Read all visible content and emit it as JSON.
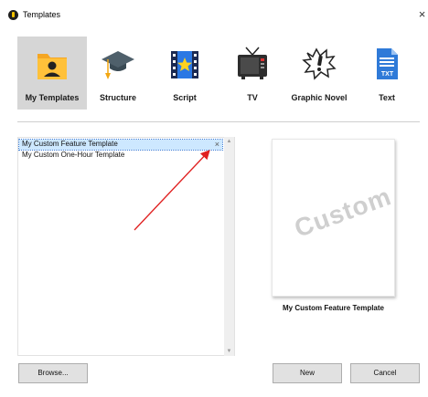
{
  "window": {
    "title": "Templates",
    "close_glyph": "×"
  },
  "categories": [
    {
      "label": "My Templates",
      "icon": "folder-user-icon",
      "selected": true
    },
    {
      "label": "Structure",
      "icon": "graduation-cap-icon",
      "selected": false
    },
    {
      "label": "Script",
      "icon": "film-strip-star-icon",
      "selected": false
    },
    {
      "label": "TV",
      "icon": "television-icon",
      "selected": false
    },
    {
      "label": "Graphic Novel",
      "icon": "speech-bubble-exclaim-icon",
      "selected": false
    },
    {
      "label": "Text",
      "icon": "txt-document-icon",
      "selected": false
    }
  ],
  "template_list": {
    "items": [
      {
        "label": "My Custom Feature Template",
        "selected": true,
        "delete_glyph": "×"
      },
      {
        "label": "My Custom One-Hour Template",
        "selected": false
      }
    ]
  },
  "preview": {
    "watermark": "Custom",
    "caption": "My Custom Feature Template"
  },
  "buttons": {
    "browse": "Browse...",
    "new": "New",
    "cancel": "Cancel"
  },
  "colors": {
    "selected_category_bg": "#d6d6d6",
    "selected_item_bg": "#cde8ff",
    "annotation_arrow": "#e02020"
  }
}
